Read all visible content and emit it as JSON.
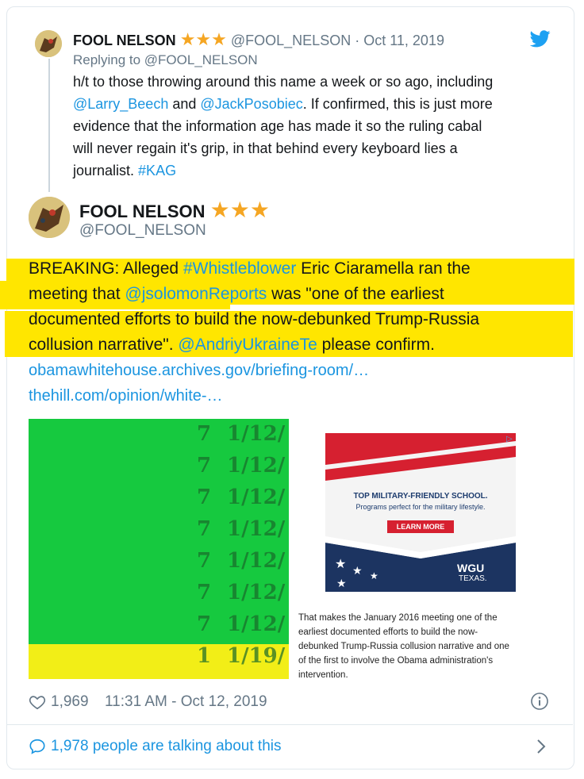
{
  "parent_tweet": {
    "author_name": "FOOL NELSON",
    "stars": "★★★",
    "handle": "@FOOL_NELSON",
    "separator": "·",
    "date": "Oct 11, 2019",
    "replying_to": "Replying to @FOOL_NELSON",
    "text_lines": [
      [
        {
          "t": "h/t to those throwing around this name a week or so ago, including",
          "link": false
        }
      ],
      [
        {
          "t": "@Larry_Beech",
          "link": true
        },
        {
          "t": " and ",
          "link": false
        },
        {
          "t": "@JackPosobiec",
          "link": true
        },
        {
          "t": ". If confirmed, this is just more",
          "link": false
        }
      ],
      [
        {
          "t": "evidence that the information age has made it so the ruling cabal",
          "link": false
        }
      ],
      [
        {
          "t": "will never regain it's grip, in that behind every keyboard lies a",
          "link": false
        }
      ],
      [
        {
          "t": "journalist. ",
          "link": false
        },
        {
          "t": "#KAG",
          "link": true
        }
      ]
    ]
  },
  "main_tweet": {
    "author_name": "FOOL NELSON",
    "stars": "★★★",
    "handle": "@FOOL_NELSON",
    "text_lines": [
      [
        {
          "t": "BREAKING: Alleged ",
          "link": false
        },
        {
          "t": "#Whistleblower",
          "link": true
        },
        {
          "t": " Eric Ciaramella ran the",
          "link": false
        }
      ],
      [
        {
          "t": "meeting that ",
          "link": false
        },
        {
          "t": "@jsolomonReports",
          "link": true
        },
        {
          "t": " was \"one of the earliest",
          "link": false
        }
      ],
      [
        {
          "t": "documented efforts to build the now-debunked Trump-Russia",
          "link": false
        }
      ],
      [
        {
          "t": "collusion narrative\". ",
          "link": false
        },
        {
          "t": "@AndriyUkraineTe",
          "link": true
        },
        {
          "t": " please confirm.",
          "link": false
        }
      ]
    ],
    "links": [
      "obamawhitehouse.archives.gov/briefing-room/…",
      "thehill.com/opinion/white-…"
    ],
    "image_left": {
      "rows": [
        {
          "num": "7",
          "date": "1/12/"
        },
        {
          "num": "7",
          "date": "1/12/"
        },
        {
          "num": "7",
          "date": "1/12/"
        },
        {
          "num": "7",
          "date": "1/12/"
        },
        {
          "num": "7",
          "date": "1/12/"
        },
        {
          "num": "7",
          "date": "1/12/"
        },
        {
          "num": "7",
          "date": "1/12/"
        },
        {
          "num": "1",
          "date": "1/19/"
        }
      ]
    },
    "image_right": {
      "ad_headline": "TOP MILITARY-FRIENDLY SCHOOL.",
      "ad_sub": "Programs perfect for the military lifestyle.",
      "ad_button": "LEARN MORE",
      "ad_brand": "WGU",
      "ad_brand_sub": "TEXAS.",
      "caption_lines": [
        "That makes the January 2016 meeting one of the",
        "earliest documented efforts to build the now-",
        "debunked Trump-Russia collusion narrative and one",
        "of the first to involve the Obama administration's",
        "intervention."
      ]
    },
    "likes": "1,969",
    "timestamp": "11:31 AM - Oct 12, 2019",
    "conversation": "1,978 people are talking about this"
  },
  "colors": {
    "link": "#1b95e0",
    "star": "#f5a623",
    "highlight": "#ffe600",
    "twitter_blue": "#1da1f2",
    "sheet_green": "#16c93f",
    "sheet_yellow": "#f2ee17"
  },
  "icons": [
    "twitter-bird-icon",
    "heart-icon",
    "info-icon",
    "chat-bubble-icon",
    "chevron-right-icon",
    "ad-choices-icon"
  ]
}
